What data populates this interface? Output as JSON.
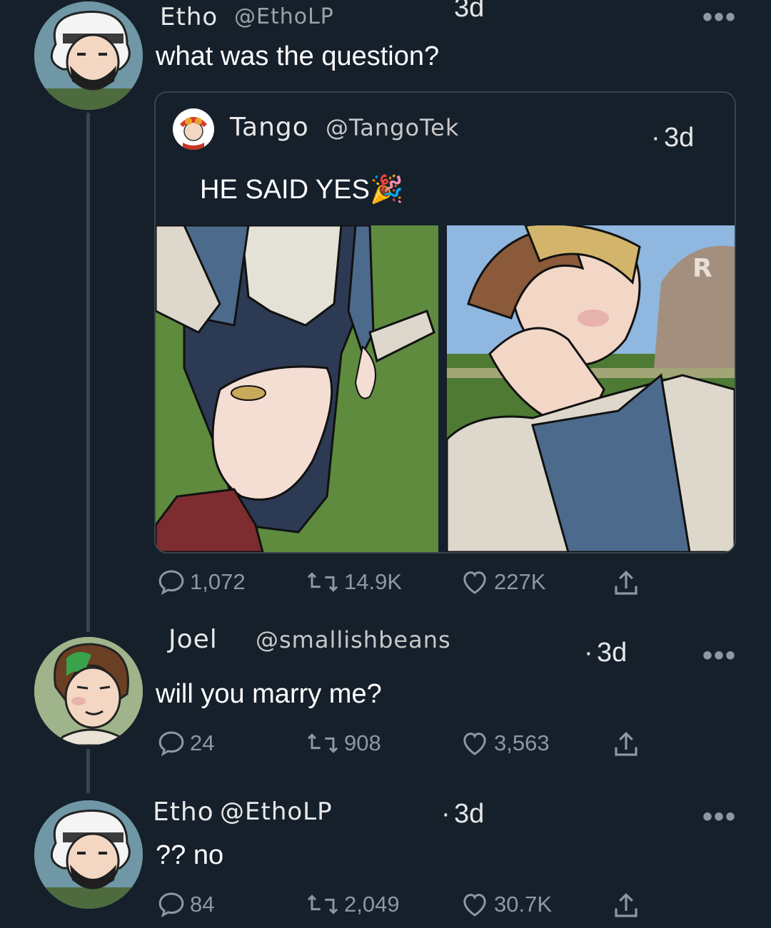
{
  "tweets": [
    {
      "name": "Etho",
      "handle": "@EthoLP",
      "time": "3d",
      "text": "what was the question?"
    },
    {
      "name": "Joel",
      "handle": "@smallishbeans",
      "time": "3d",
      "text": "will you marry me?",
      "stats": {
        "replies": "24",
        "retweets": "908",
        "likes": "3,563"
      }
    },
    {
      "name": "Etho",
      "handle": "@EthoLP",
      "time": "3d",
      "text": "?? no",
      "stats": {
        "replies": "84",
        "retweets": "2,049",
        "likes": "30.7K"
      }
    }
  ],
  "quoted": {
    "name": "Tango",
    "handle": "@TangoTek",
    "time": "3d",
    "text": "HE SAID YES🎉",
    "stats": {
      "replies": "1,072",
      "retweets": "14.9K",
      "likes": "227K"
    },
    "barn_letter": "R"
  },
  "more_label": "•••",
  "colors": {
    "background": "#15202b",
    "line": "#38444d",
    "muted": "#8b98a5"
  },
  "icons": [
    "reply-icon",
    "retweet-icon",
    "like-icon",
    "share-icon",
    "more-icon"
  ]
}
